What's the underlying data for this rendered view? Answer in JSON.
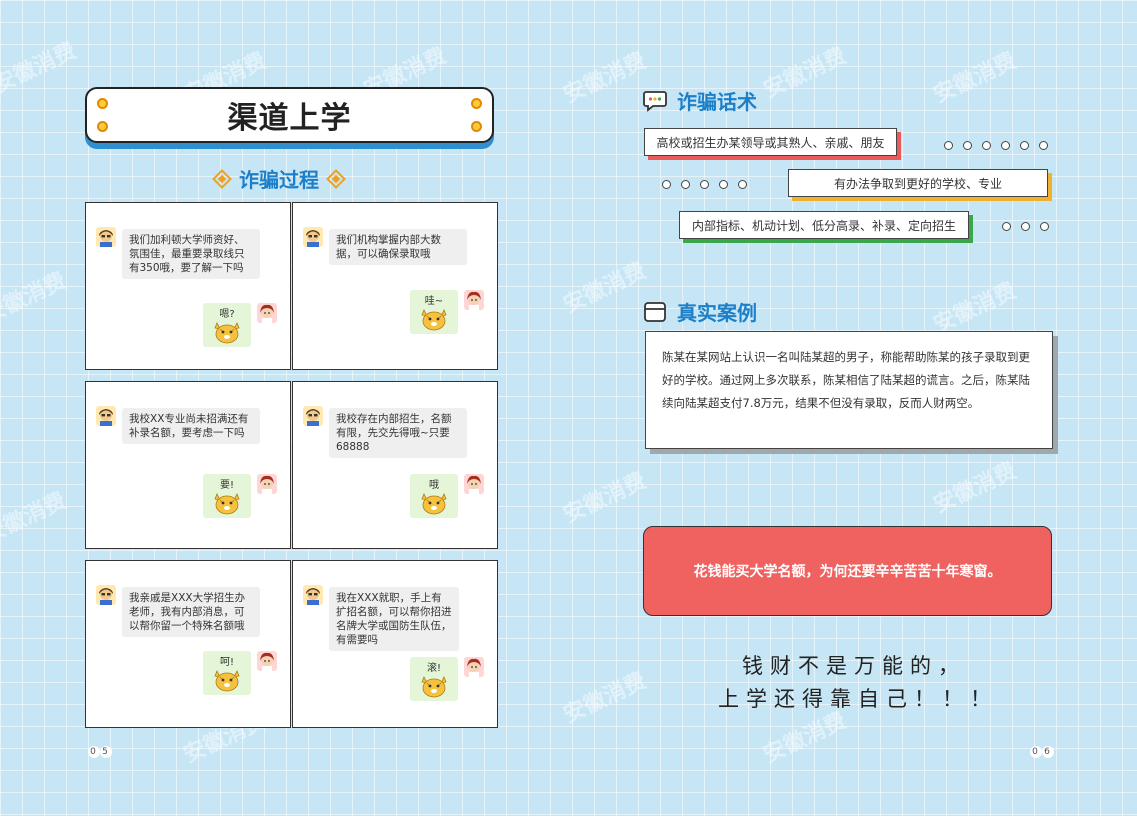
{
  "left_page": {
    "title": "渠道上学",
    "section_title": "诈骗过程",
    "page_number": [
      "0",
      "5"
    ],
    "panels": [
      {
        "message": "我们加利顿大学师资好、氛围佳，最重要录取线只有350哦，要了解一下吗",
        "reply": "嗯?"
      },
      {
        "message": "我们机构掌握内部大数据，可以确保录取哦",
        "reply": "哇~"
      },
      {
        "message": "我校XX专业尚未招满还有补录名额，要考虑一下吗",
        "reply": "要!"
      },
      {
        "message": "我校存在内部招生，名额有限，先交先得哦~只要68888",
        "reply": "哦"
      },
      {
        "message": "我亲戚是XXX大学招生办老师，我有内部消息，可以帮你留一个特殊名额哦",
        "reply": "呵!"
      },
      {
        "message": "我在XXX就职，手上有扩招名额，可以帮你招进名牌大学或国防生队伍，有需要吗",
        "reply": "滚!"
      }
    ]
  },
  "right_page": {
    "fraud_talk_title": "诈骗话术",
    "tags": [
      {
        "text": "高校或招生办某领导或其熟人、亲戚、朋友",
        "color": "#e85b5b"
      },
      {
        "text": "有办法争取到更好的学校、专业",
        "color": "#f0b030"
      },
      {
        "text": "内部指标、机动计划、低分高录、补录、定向招生",
        "color": "#3aa84a"
      }
    ],
    "case_title": "真实案例",
    "case_text": "陈某在某网站上认识一名叫陆某超的男子，称能帮助陈某的孩子录取到更好的学校。通过网上多次联系，陈某相信了陆某超的谎言。之后，陈某陆续向陆某超支付7.8万元，结果不但没有录取，反而人财两空。",
    "highlight": "花钱能买大学名额，为何还要辛辛苦苦十年寒窗。",
    "slogan_line1": "钱财不是万能的，",
    "slogan_line2": "上学还得靠自己！！！",
    "page_number": [
      "0",
      "6"
    ]
  },
  "colors": {
    "accent_blue": "#1d7fc8",
    "banner_shadow": "#2f8fd0",
    "alert_red": "#f06260"
  },
  "icons": [
    "diamond-icon",
    "chat-bubble-icon",
    "card-icon",
    "avatar-icon",
    "tiger-sticker-icon"
  ]
}
